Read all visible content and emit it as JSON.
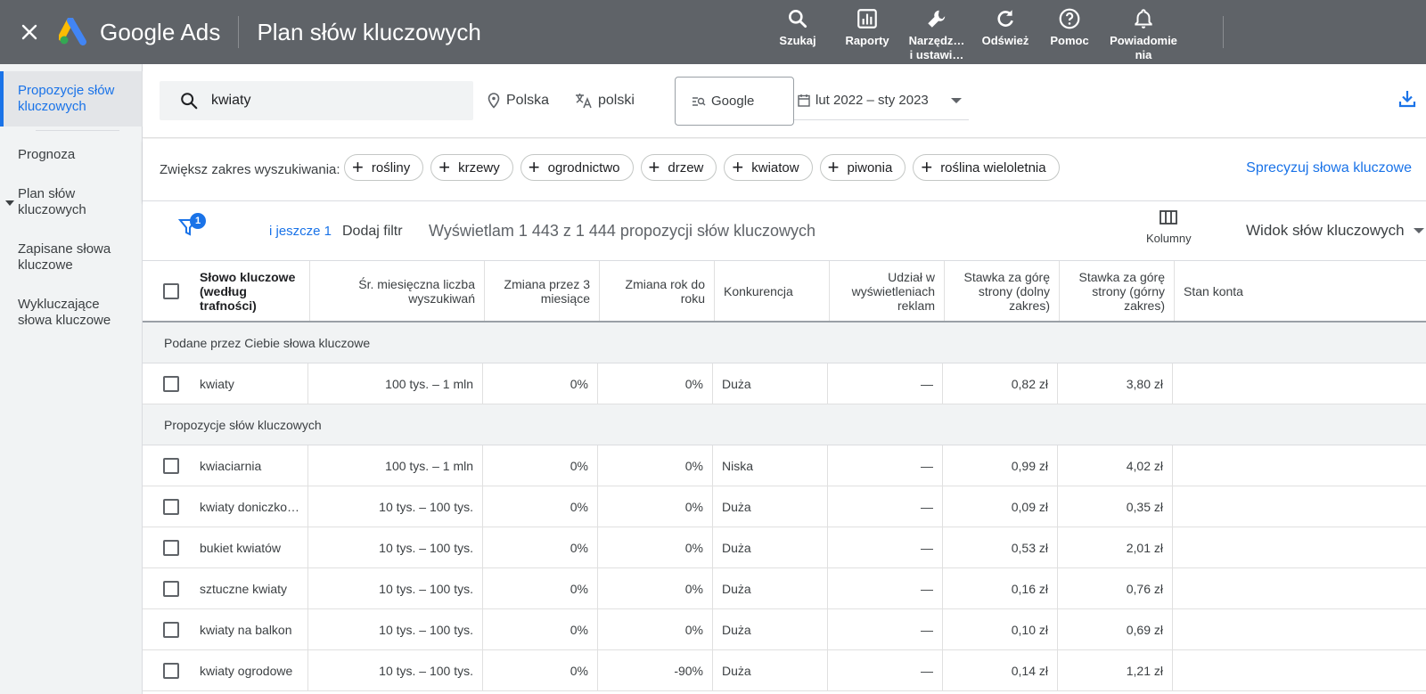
{
  "app": {
    "brand": "Google Ads",
    "page_title": "Plan słów kluczowych"
  },
  "top_actions": [
    {
      "label": "Szukaj",
      "icon": "search-icon"
    },
    {
      "label": "Raporty",
      "icon": "reports-icon"
    },
    {
      "label": "Narzędz…\ni ustawi…",
      "icon": "wrench-icon"
    },
    {
      "label": "Odśwież",
      "icon": "refresh-icon"
    },
    {
      "label": "Pomoc",
      "icon": "help-icon"
    },
    {
      "label": "Powiadomie\nnia",
      "icon": "bell-icon"
    }
  ],
  "sidebar": {
    "items": [
      {
        "label": "Propozycje słów kluczowych",
        "active": true
      },
      {
        "label": "Prognoza"
      },
      {
        "label": "Plan słów kluczowych"
      },
      {
        "label": "Zapisane słowa kluczowe"
      },
      {
        "label": "Wykluczające słowa kluczowe"
      }
    ]
  },
  "search": {
    "query": "kwiaty",
    "location": "Polska",
    "language": "polski",
    "network": "Google",
    "date_range": "lut 2022 – sty 2023"
  },
  "broaden": {
    "label": "Zwiększ zakres wyszukiwania:",
    "chips": [
      "rośliny",
      "krzewy",
      "ogrodnictwo",
      "drzew",
      "kwiatow",
      "piwonia",
      "roślina wieloletnia"
    ],
    "refine_link": "Sprecyzuj słowa kluczowe"
  },
  "toolbar": {
    "filter_count": "1",
    "more_link": "i jeszcze 1",
    "add_filter": "Dodaj filtr",
    "showing": "Wyświetlam 1 443 z 1 444 propozycji słów kluczowych",
    "columns_label": "Kolumny",
    "view_label": "Widok słów kluczowych"
  },
  "table": {
    "headers": [
      "Słowo kluczowe (według trafności)",
      "Śr. miesięczna liczba wyszukiwań",
      "Zmiana przez 3 miesiące",
      "Zmiana rok do roku",
      "Konkurencja",
      "Udział w wyświetleniach reklam",
      "Stawka za górę strony (dolny zakres)",
      "Stawka za górę strony (górny zakres)",
      "Stan konta"
    ],
    "group1_label": "Podane przez Ciebie słowa kluczowe",
    "group1_rows": [
      [
        "kwiaty",
        "100 tys. – 1 mln",
        "0%",
        "0%",
        "Duża",
        "—",
        "0,82 zł",
        "3,80 zł",
        ""
      ]
    ],
    "group2_label": "Propozycje słów kluczowych",
    "group2_rows": [
      [
        "kwiaciarnia",
        "100 tys. – 1 mln",
        "0%",
        "0%",
        "Niska",
        "—",
        "0,99 zł",
        "4,02 zł",
        ""
      ],
      [
        "kwiaty doniczko…",
        "10 tys. – 100 tys.",
        "0%",
        "0%",
        "Duża",
        "—",
        "0,09 zł",
        "0,35 zł",
        ""
      ],
      [
        "bukiet kwiatów",
        "10 tys. – 100 tys.",
        "0%",
        "0%",
        "Duża",
        "—",
        "0,53 zł",
        "2,01 zł",
        ""
      ],
      [
        "sztuczne kwiaty",
        "10 tys. – 100 tys.",
        "0%",
        "0%",
        "Duża",
        "—",
        "0,16 zł",
        "0,76 zł",
        ""
      ],
      [
        "kwiaty na balkon",
        "10 tys. – 100 tys.",
        "0%",
        "0%",
        "Duża",
        "—",
        "0,10 zł",
        "0,69 zł",
        ""
      ],
      [
        "kwiaty ogrodowe",
        "10 tys. – 100 tys.",
        "0%",
        "-90%",
        "Duża",
        "—",
        "0,14 zł",
        "1,21 zł",
        ""
      ]
    ]
  },
  "colors": {
    "topbar": "#5f6368",
    "accent": "#1a73e8",
    "sidebar": "#f1f3f4"
  }
}
